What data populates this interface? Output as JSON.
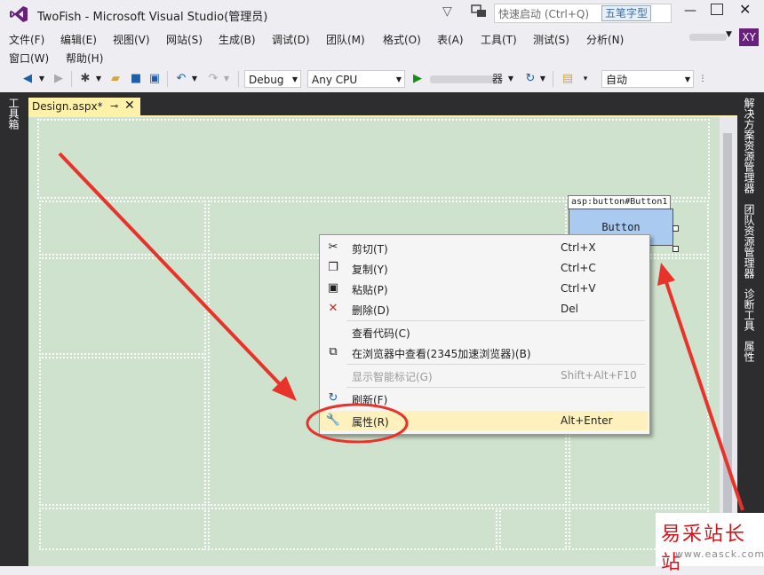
{
  "window": {
    "title": "TwoFish - Microsoft Visual Studio(管理员)",
    "quick_launch_placeholder": "快速启动 (Ctrl+Q)",
    "ime_badge": "五笔字型",
    "user_initials": "XY",
    "accent": "#68217a"
  },
  "menu": {
    "row1": [
      "文件(F)",
      "编辑(E)",
      "视图(V)",
      "网站(S)",
      "生成(B)",
      "调试(D)",
      "团队(M)",
      "格式(O)",
      "表(A)",
      "工具(T)",
      "测试(S)",
      "分析(N)"
    ],
    "row2": [
      "窗口(W)",
      "帮助(H)"
    ]
  },
  "toolbar": {
    "configuration": "Debug",
    "platform": "Any CPU",
    "run_target_suffix": "器",
    "zoom": "自动"
  },
  "left_dock": {
    "toolbox": "工具箱"
  },
  "right_dock": {
    "tabs": [
      "解决方案资源管理器",
      "团队资源管理器",
      "诊断工具",
      "属性"
    ]
  },
  "document": {
    "tab_label": "Design.aspx*",
    "tab_color": "#fff1a8"
  },
  "designer": {
    "background": "#cfe2cd",
    "control_tag": "asp:button#Button1",
    "button_text": "Button"
  },
  "context_menu": {
    "items": [
      {
        "icon": "scissors-icon",
        "label": "剪切(T)",
        "shortcut": "Ctrl+X",
        "enabled": true
      },
      {
        "icon": "copy-icon",
        "label": "复制(Y)",
        "shortcut": "Ctrl+C",
        "enabled": true
      },
      {
        "icon": "paste-icon",
        "label": "粘贴(P)",
        "shortcut": "Ctrl+V",
        "enabled": true
      },
      {
        "icon": "delete-icon",
        "label": "删除(D)",
        "shortcut": "Del",
        "enabled": true
      },
      {
        "icon": "",
        "label": "查看代码(C)",
        "shortcut": "",
        "enabled": true
      },
      {
        "icon": "browser-icon",
        "label": "在浏览器中查看(2345加速浏览器)(B)",
        "shortcut": "",
        "enabled": true
      },
      {
        "icon": "",
        "label": "显示智能标记(G)",
        "shortcut": "Shift+Alt+F10",
        "enabled": false
      },
      {
        "icon": "refresh-icon",
        "label": "刷新(F)",
        "shortcut": "",
        "enabled": true
      },
      {
        "icon": "wrench-icon",
        "label": "属性(R)",
        "shortcut": "Alt+Enter",
        "enabled": true,
        "highlighted": true
      }
    ]
  },
  "annotation_color": "#e8332a",
  "watermark": {
    "title": "易采站长站",
    "url": "www.easck.com"
  }
}
